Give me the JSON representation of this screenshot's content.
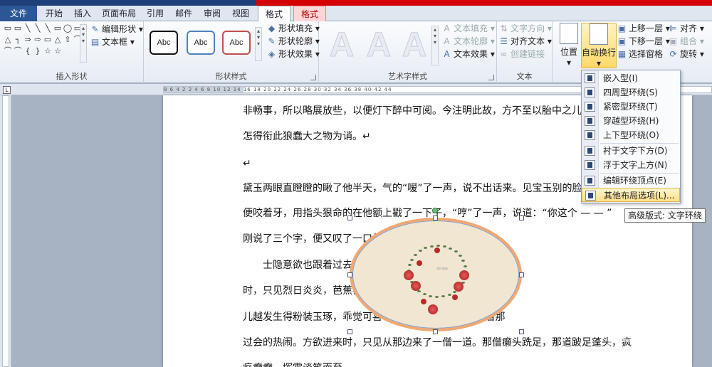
{
  "tabs": [
    "文件",
    "开始",
    "插入",
    "页面布局",
    "引用",
    "邮件",
    "审阅",
    "视图",
    "格式",
    "格式"
  ],
  "ribbon": {
    "insert_shapes": {
      "label": "插入形状",
      "edit_shape": "编辑形状",
      "text_box": "文本框",
      "shape_glyphs": [
        "▭",
        "▭",
        "╲",
        "╲",
        "╲",
        "▭",
        "◯",
        "▭",
        "△",
        "┐",
        "⇒",
        "⇨",
        "▭",
        "△",
        "⇧",
        "⌒",
        "⌒",
        "⌒",
        "{",
        "}",
        "☆",
        "☆"
      ]
    },
    "shape_styles": {
      "label": "形状样式",
      "samples": [
        "Abc",
        "Abc",
        "Abc"
      ],
      "fill": "形状填充",
      "outline": "形状轮廓",
      "effects": "形状效果"
    },
    "wordart": {
      "label": "艺术字样式",
      "samples": [
        "A",
        "A",
        "A"
      ],
      "text_fill": "文本填充",
      "text_outline": "文本轮廓",
      "text_effects": "文本效果"
    },
    "text": {
      "label": "文本",
      "direction": "文字方向",
      "align": "对齐文本",
      "link": "创建链接"
    },
    "arrange": {
      "position": "位置",
      "auto_wrap": "自动换行",
      "bring_forward": "上移一层",
      "send_backward": "下移一层",
      "selection_pane": "选择窗格",
      "align": "对齐",
      "group": "组合",
      "rotate": "旋转"
    }
  },
  "wrap_menu": {
    "items": [
      "嵌入型(I)",
      "四周型环绕(S)",
      "紧密型环绕(T)",
      "穿越型环绕(H)",
      "上下型环绕(O)",
      "衬于文字下方(D)",
      "浮于文字上方(N)",
      "编辑环绕顶点(E)",
      "其他布局选项(L)..."
    ],
    "hovered_index": 8
  },
  "tooltip": "高级版式: 文字环绕",
  "ruler": {
    "corner": "L",
    "scale_text": "8   6   4   2       2   4   6   8   10   12   14   16   18   20   22   24   26   28   30   32   34   36   38   40   42   44"
  },
  "document": {
    "paragraphs": [
      "非畅事，所以略展放些，以便灯下醉中可阅。今注明此故，方不至以胎中之儿口有",
      "怎得衔此狼蠢大之物为诮。↵",
      "↵",
      "黛玉两眼直瞪瞪的瞅了他半天，气的“嗳”了一声，说不出话来。见宝玉别的脸上",
      "便咬着牙，用指头狠命的在他额上戳了一下子，“哼”了一声，说道：“你这个 —  — ”",
      "刚说了三个字，便又叹了一口气",
      "士隐意欲也跟着过去                                 士隐大叫一声，定睛看",
      "时，只见烈日炎炎，芭蕉冉                              了英莲走来。士隐见女",
      "儿越发生得粉装玉琢，乖觉可喜                            耍一回；又带至街前，看那",
      "过会的热闹。方欲进来时，只见从那边来了一僧一道。那僧癞头跣足，那道跛足蓬头，疯",
      "疯癫癫，挥霍谈笑而至。"
    ]
  },
  "picture": {
    "caption": "花环装饰",
    "ellipse_fill": "#f1e6d2",
    "ellipse_border": "#f0a872"
  },
  "watermark": {
    "text": "Bai",
    "sub": "jingyan.baidu.com"
  },
  "colors": {
    "accent_blue": "#2b5797",
    "context_red": "#d40000",
    "menu_highlight": "#ffe08a"
  }
}
